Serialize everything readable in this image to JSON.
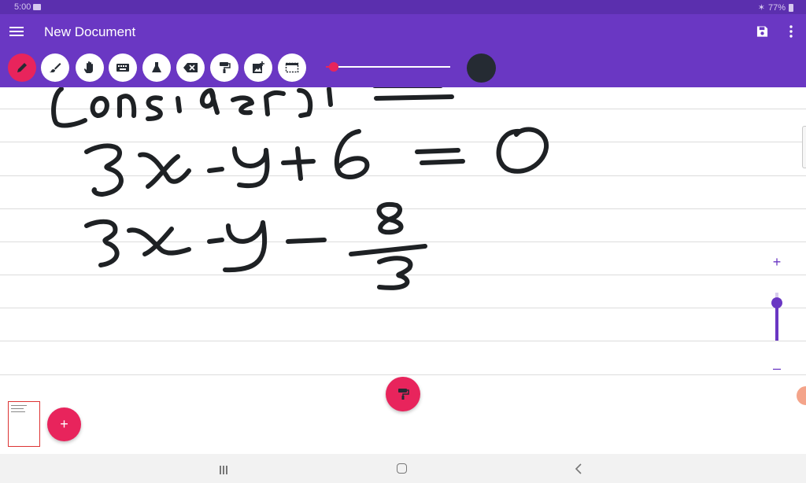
{
  "status_bar": {
    "time": "5:00",
    "battery": "77%"
  },
  "app_bar": {
    "title": "New Document"
  },
  "toolbar": {
    "tools": [
      {
        "name": "pen-tool",
        "icon": "pen-icon",
        "active": true
      },
      {
        "name": "highlighter-tool",
        "icon": "brush-icon",
        "active": false
      },
      {
        "name": "pan-tool",
        "icon": "hand-icon",
        "active": false
      },
      {
        "name": "keyboard-tool",
        "icon": "keyboard-icon",
        "active": false
      },
      {
        "name": "flask-tool",
        "icon": "flask-icon",
        "active": false
      },
      {
        "name": "eraser-tool",
        "icon": "backspace-icon",
        "active": false
      },
      {
        "name": "paint-roller-tool",
        "icon": "paint-roller-icon",
        "active": false
      },
      {
        "name": "add-image-tool",
        "icon": "add-photo-icon",
        "active": false
      },
      {
        "name": "select-area-tool",
        "icon": "selection-icon",
        "active": false
      }
    ],
    "stroke_width_fraction": 0.05,
    "pen_color": "#252b33"
  },
  "canvas": {
    "handwriting_lines": [
      "Consider y =",
      "3x - y + 6 = 0",
      "3x - y - 8/3"
    ],
    "zoom_plus_label": "+",
    "zoom_minus_label": "–",
    "zoom_level_fraction": 0.25
  },
  "fabs": {
    "add_page_label": "+"
  },
  "colors": {
    "primary": "#6a37c3",
    "status_bar": "#5b2fae",
    "accent": "#e8245c"
  }
}
